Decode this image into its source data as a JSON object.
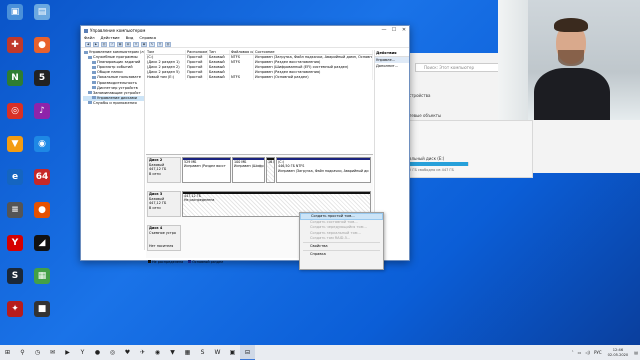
{
  "desktop": {
    "icons": [
      {
        "label": "",
        "glyph": "▣",
        "color": "#4a90d9"
      },
      {
        "label": "",
        "glyph": "▤",
        "color": "#6aa8e0"
      },
      {
        "label": "",
        "glyph": "✚",
        "color": "#c0392b"
      },
      {
        "label": "",
        "glyph": "●",
        "color": "#e8612c"
      },
      {
        "label": "",
        "glyph": "N",
        "color": "#2e7d32"
      },
      {
        "label": "",
        "glyph": "5",
        "color": "#222222"
      },
      {
        "label": "",
        "glyph": "◎",
        "color": "#d93025"
      },
      {
        "label": "",
        "glyph": "♪",
        "color": "#8e24aa"
      },
      {
        "label": "",
        "glyph": "▼",
        "color": "#f39c12"
      },
      {
        "label": "",
        "glyph": "◉",
        "color": "#1e88e5"
      },
      {
        "label": "",
        "glyph": "e",
        "color": "#1565c0"
      },
      {
        "label": "",
        "glyph": "64",
        "color": "#c62828"
      },
      {
        "label": "",
        "glyph": "≡",
        "color": "#555555"
      },
      {
        "label": "",
        "glyph": "●",
        "color": "#e65100"
      },
      {
        "label": "",
        "glyph": "Y",
        "color": "#d50000"
      },
      {
        "label": "",
        "glyph": "◢",
        "color": "#111111"
      },
      {
        "label": "",
        "glyph": "S",
        "color": "#1b2838"
      },
      {
        "label": "",
        "glyph": "▦",
        "color": "#43a047"
      },
      {
        "label": "",
        "glyph": "✦",
        "color": "#b71c1c"
      },
      {
        "label": "",
        "glyph": "■",
        "color": "#333333"
      }
    ]
  },
  "background_window": {
    "search_placeholder": "Поиск: Этот компьютер",
    "text_devices": "стройства",
    "text_network": "тевые объекты",
    "disk_caption": "альный диск (E:)",
    "disk_free": "2 ГБ свободно из 447 ГБ",
    "disk_used_fraction": 0.98
  },
  "window": {
    "title": "Управление компьютером",
    "controls": {
      "minimize": "—",
      "maximize": "☐",
      "close": "✕"
    },
    "menu": [
      "Файл",
      "Действие",
      "Вид",
      "Справка"
    ],
    "toolbar": [
      "◀",
      "▶",
      "▥",
      "?",
      "▦",
      "▤",
      "✕",
      "▣",
      "✎",
      "⚲",
      "▧"
    ],
    "tree": [
      {
        "label": "Управление компьютером (л",
        "indent": 0
      },
      {
        "label": "Служебные программы",
        "indent": 1
      },
      {
        "label": "Планировщик заданий",
        "indent": 2
      },
      {
        "label": "Просмотр событий",
        "indent": 2
      },
      {
        "label": "Общие папки",
        "indent": 2
      },
      {
        "label": "Локальные пользовате",
        "indent": 2
      },
      {
        "label": "Производительность",
        "indent": 2
      },
      {
        "label": "Диспетчер устройств",
        "indent": 2
      },
      {
        "label": "Запоминающие устройст",
        "indent": 1
      },
      {
        "label": "Управление дисками",
        "indent": 2,
        "selected": true
      },
      {
        "label": "Службы и приложения",
        "indent": 1
      }
    ],
    "volumes": {
      "headers": [
        "Том",
        "Расположение",
        "Тип",
        "Файловая система",
        "Состояние"
      ],
      "rows": [
        [
          "(C:)",
          "Простой",
          "Базовый",
          "NTFS",
          "Исправен (Загрузка, Файл подкачки, Аварийный дамп, Основной ра"
        ],
        [
          "(Диск 2 раздел 1)",
          "Простой",
          "Базовый",
          "NTFS",
          "Исправен (Раздел восстановления)"
        ],
        [
          "(Диск 2 раздел 2)",
          "Простой",
          "Базовый",
          "",
          "Исправен (Шифрованный (EFI) системный раздел)"
        ],
        [
          "(Диск 2 раздел 5)",
          "Простой",
          "Базовый",
          "",
          "Исправен (Раздел восстановления)"
        ],
        [
          "Новый том (E:)",
          "Простой",
          "Базовый",
          "NTFS",
          "Исправен (Основной раздел)"
        ]
      ]
    },
    "actions": {
      "header": "Действия",
      "selected": "Управле...",
      "more": "Дополнит..."
    },
    "disks": {
      "disk2": {
        "name": "Диск 2",
        "type": "Базовый",
        "size": "447,12 ГБ",
        "state": "В сети",
        "partitions": [
          {
            "l1": "529 МБ",
            "l2": "Исправен (Раздел восст"
          },
          {
            "l1": "100 МБ",
            "l2": "Исправен (Шифр"
          },
          {
            "l1": "16 МБ",
            "l2": ""
          },
          {
            "l1": "(C:)",
            "l2": "446,50 ГБ NTFS",
            "l3": "Исправен (Загрузка, Файл подкачки, Аварийный ди"
          }
        ]
      },
      "disk3": {
        "name": "Диск 3",
        "type": "Базовый",
        "size": "447,12 ГБ",
        "state": "В сети",
        "partition": {
          "l1": "447,12 ГБ",
          "l2": "Не распределена"
        }
      },
      "disk4": {
        "name": "Диск 4",
        "type": "Съемное устро",
        "state": "Нет носителя"
      }
    },
    "legend": {
      "unallocated": "Не распределена",
      "primary": "Основной раздел"
    }
  },
  "context_menu": {
    "items": [
      {
        "label": "Создать простой том...",
        "enabled": true,
        "highlighted": true
      },
      {
        "label": "Создать составной том...",
        "enabled": false
      },
      {
        "label": "Создать чередующийся том...",
        "enabled": false
      },
      {
        "label": "Создать зеркальный том...",
        "enabled": false
      },
      {
        "label": "Создать том RAID-5...",
        "enabled": false
      },
      {
        "separator": true
      },
      {
        "label": "Свойства",
        "enabled": true
      },
      {
        "separator": true
      },
      {
        "label": "Справка",
        "enabled": true
      }
    ]
  },
  "taskbar": {
    "items": [
      "⊞",
      "⚲",
      "◷",
      "✉",
      "▶",
      "Y",
      "●",
      "◎",
      "♥",
      "✈",
      "◉",
      "▼",
      "▦",
      "S",
      "W",
      "▣",
      "⊟"
    ],
    "active_index": 16,
    "tray": {
      "lang": "РУС",
      "time": "12:46",
      "date": "02.05.2020"
    }
  }
}
